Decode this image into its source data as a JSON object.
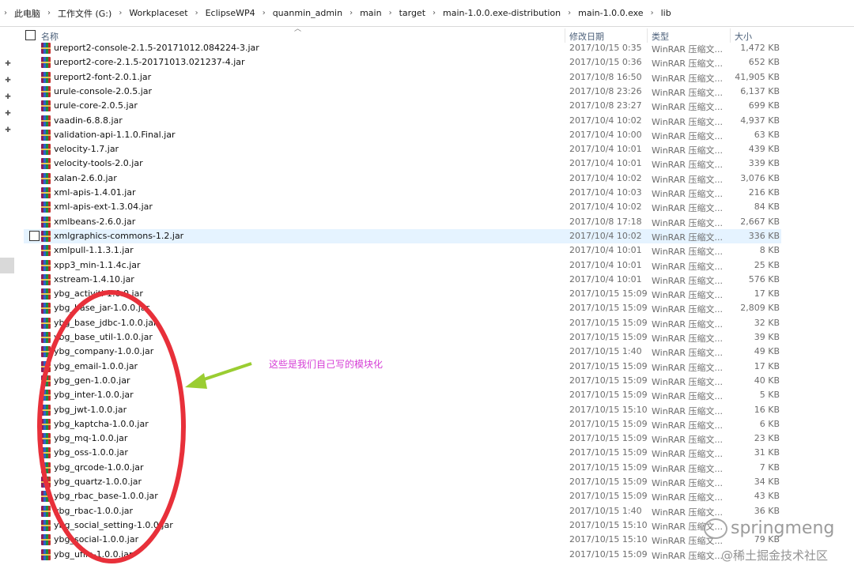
{
  "breadcrumb": [
    "此电脑",
    "工作文件 (G:)",
    "Workplaceset",
    "EclipseWP4",
    "quanmin_admin",
    "main",
    "target",
    "main-1.0.0.exe-distribution",
    "main-1.0.0.exe",
    "lib"
  ],
  "columns": {
    "name": "名称",
    "date": "修改日期",
    "type": "类型",
    "size": "大小"
  },
  "files": [
    {
      "name": "ureport2-console-2.1.5-20171012.084224-3.jar",
      "date": "2017/10/15 0:35",
      "type": "WinRAR 压缩文...",
      "size": "1,472 KB"
    },
    {
      "name": "ureport2-core-2.1.5-20171013.021237-4.jar",
      "date": "2017/10/15 0:36",
      "type": "WinRAR 压缩文...",
      "size": "652 KB"
    },
    {
      "name": "ureport2-font-2.0.1.jar",
      "date": "2017/10/8 16:50",
      "type": "WinRAR 压缩文...",
      "size": "41,905 KB"
    },
    {
      "name": "urule-console-2.0.5.jar",
      "date": "2017/10/8 23:26",
      "type": "WinRAR 压缩文...",
      "size": "6,137 KB"
    },
    {
      "name": "urule-core-2.0.5.jar",
      "date": "2017/10/8 23:27",
      "type": "WinRAR 压缩文...",
      "size": "699 KB"
    },
    {
      "name": "vaadin-6.8.8.jar",
      "date": "2017/10/4 10:02",
      "type": "WinRAR 压缩文...",
      "size": "4,937 KB"
    },
    {
      "name": "validation-api-1.1.0.Final.jar",
      "date": "2017/10/4 10:00",
      "type": "WinRAR 压缩文...",
      "size": "63 KB"
    },
    {
      "name": "velocity-1.7.jar",
      "date": "2017/10/4 10:01",
      "type": "WinRAR 压缩文...",
      "size": "439 KB"
    },
    {
      "name": "velocity-tools-2.0.jar",
      "date": "2017/10/4 10:01",
      "type": "WinRAR 压缩文...",
      "size": "339 KB"
    },
    {
      "name": "xalan-2.6.0.jar",
      "date": "2017/10/4 10:02",
      "type": "WinRAR 压缩文...",
      "size": "3,076 KB"
    },
    {
      "name": "xml-apis-1.4.01.jar",
      "date": "2017/10/4 10:03",
      "type": "WinRAR 压缩文...",
      "size": "216 KB"
    },
    {
      "name": "xml-apis-ext-1.3.04.jar",
      "date": "2017/10/4 10:02",
      "type": "WinRAR 压缩文...",
      "size": "84 KB"
    },
    {
      "name": "xmlbeans-2.6.0.jar",
      "date": "2017/10/8 17:18",
      "type": "WinRAR 压缩文...",
      "size": "2,667 KB"
    },
    {
      "name": "xmlgraphics-commons-1.2.jar",
      "date": "2017/10/4 10:02",
      "type": "WinRAR 压缩文...",
      "size": "336 KB",
      "selected": true
    },
    {
      "name": "xmlpull-1.1.3.1.jar",
      "date": "2017/10/4 10:01",
      "type": "WinRAR 压缩文...",
      "size": "8 KB"
    },
    {
      "name": "xpp3_min-1.1.4c.jar",
      "date": "2017/10/4 10:01",
      "type": "WinRAR 压缩文...",
      "size": "25 KB"
    },
    {
      "name": "xstream-1.4.10.jar",
      "date": "2017/10/4 10:01",
      "type": "WinRAR 压缩文...",
      "size": "576 KB"
    },
    {
      "name": "ybg_activiti-1.0.0.jar",
      "date": "2017/10/15 15:09",
      "type": "WinRAR 压缩文...",
      "size": "17 KB"
    },
    {
      "name": "ybg_base_jar-1.0.0.jar",
      "date": "2017/10/15 15:09",
      "type": "WinRAR 压缩文...",
      "size": "2,809 KB"
    },
    {
      "name": "ybg_base_jdbc-1.0.0.jar",
      "date": "2017/10/15 15:09",
      "type": "WinRAR 压缩文...",
      "size": "32 KB"
    },
    {
      "name": "ybg_base_util-1.0.0.jar",
      "date": "2017/10/15 15:09",
      "type": "WinRAR 压缩文...",
      "size": "39 KB"
    },
    {
      "name": "ybg_company-1.0.0.jar",
      "date": "2017/10/15 1:40",
      "type": "WinRAR 压缩文...",
      "size": "49 KB"
    },
    {
      "name": "ybg_email-1.0.0.jar",
      "date": "2017/10/15 15:09",
      "type": "WinRAR 压缩文...",
      "size": "17 KB"
    },
    {
      "name": "ybg_gen-1.0.0.jar",
      "date": "2017/10/15 15:09",
      "type": "WinRAR 压缩文...",
      "size": "40 KB"
    },
    {
      "name": "ybg_inter-1.0.0.jar",
      "date": "2017/10/15 15:09",
      "type": "WinRAR 压缩文...",
      "size": "5 KB"
    },
    {
      "name": "ybg_jwt-1.0.0.jar",
      "date": "2017/10/15 15:10",
      "type": "WinRAR 压缩文...",
      "size": "16 KB"
    },
    {
      "name": "ybg_kaptcha-1.0.0.jar",
      "date": "2017/10/15 15:09",
      "type": "WinRAR 压缩文...",
      "size": "6 KB"
    },
    {
      "name": "ybg_mq-1.0.0.jar",
      "date": "2017/10/15 15:09",
      "type": "WinRAR 压缩文...",
      "size": "23 KB"
    },
    {
      "name": "ybg_oss-1.0.0.jar",
      "date": "2017/10/15 15:09",
      "type": "WinRAR 压缩文...",
      "size": "31 KB"
    },
    {
      "name": "ybg_qrcode-1.0.0.jar",
      "date": "2017/10/15 15:09",
      "type": "WinRAR 压缩文...",
      "size": "7 KB"
    },
    {
      "name": "ybg_quartz-1.0.0.jar",
      "date": "2017/10/15 15:09",
      "type": "WinRAR 压缩文...",
      "size": "34 KB"
    },
    {
      "name": "ybg_rbac_base-1.0.0.jar",
      "date": "2017/10/15 15:09",
      "type": "WinRAR 压缩文...",
      "size": "43 KB"
    },
    {
      "name": "ybg_rbac-1.0.0.jar",
      "date": "2017/10/15 1:40",
      "type": "WinRAR 压缩文...",
      "size": "36 KB"
    },
    {
      "name": "ybg_social_setting-1.0.0.jar",
      "date": "2017/10/15 15:10",
      "type": "WinRAR 压缩文...",
      "size": ""
    },
    {
      "name": "ybg_social-1.0.0.jar",
      "date": "2017/10/15 15:10",
      "type": "WinRAR 压缩文...",
      "size": "79 KB"
    },
    {
      "name": "ybg_ufile-1.0.0.jar",
      "date": "2017/10/15 15:09",
      "type": "WinRAR 压缩文...",
      "size": ""
    }
  ],
  "annotation": {
    "text": "这些是我们自己写的模块化",
    "ellipse_color": "#e8303a",
    "arrow_color": "#9acd32"
  },
  "watermark": {
    "line1": "springmeng",
    "line2": "@稀土掘金技术社区"
  },
  "colors": {
    "selected_row": "#e5f3ff",
    "header_text": "#4c607a",
    "annotation_text": "#d63fd6"
  }
}
